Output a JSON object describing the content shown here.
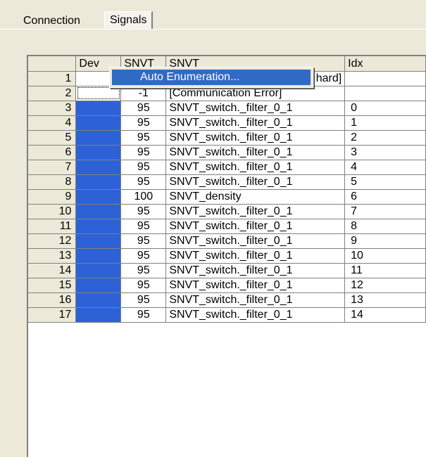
{
  "tabs": [
    {
      "label": "Connection"
    },
    {
      "label": "Signals"
    }
  ],
  "grid": {
    "headers": {
      "row": "",
      "dev": "Dev",
      "snvt_num": "SNVT",
      "snvt": "SNVT",
      "idx": "Idx"
    },
    "rows": [
      {
        "n": "1",
        "dev": "",
        "snvt_num": "",
        "snvt": "hard]",
        "idx": ""
      },
      {
        "n": "2",
        "dev": "",
        "snvt_num": "-1",
        "snvt": "[Communication Error]",
        "idx": ""
      },
      {
        "n": "3",
        "dev": "",
        "snvt_num": "95",
        "snvt": "SNVT_switch._filter_0_1",
        "idx": "0"
      },
      {
        "n": "4",
        "dev": "",
        "snvt_num": "95",
        "snvt": "SNVT_switch._filter_0_1",
        "idx": "1"
      },
      {
        "n": "5",
        "dev": "",
        "snvt_num": "95",
        "snvt": "SNVT_switch._filter_0_1",
        "idx": "2"
      },
      {
        "n": "6",
        "dev": "",
        "snvt_num": "95",
        "snvt": "SNVT_switch._filter_0_1",
        "idx": "3"
      },
      {
        "n": "7",
        "dev": "",
        "snvt_num": "95",
        "snvt": "SNVT_switch._filter_0_1",
        "idx": "4"
      },
      {
        "n": "8",
        "dev": "",
        "snvt_num": "95",
        "snvt": "SNVT_switch._filter_0_1",
        "idx": "5"
      },
      {
        "n": "9",
        "dev": "",
        "snvt_num": "100",
        "snvt": "SNVT_density",
        "idx": "6"
      },
      {
        "n": "10",
        "dev": "",
        "snvt_num": "95",
        "snvt": "SNVT_switch._filter_0_1",
        "idx": "7"
      },
      {
        "n": "11",
        "dev": "",
        "snvt_num": "95",
        "snvt": "SNVT_switch._filter_0_1",
        "idx": "8"
      },
      {
        "n": "12",
        "dev": "",
        "snvt_num": "95",
        "snvt": "SNVT_switch._filter_0_1",
        "idx": "9"
      },
      {
        "n": "13",
        "dev": "",
        "snvt_num": "95",
        "snvt": "SNVT_switch._filter_0_1",
        "idx": "10"
      },
      {
        "n": "14",
        "dev": "",
        "snvt_num": "95",
        "snvt": "SNVT_switch._filter_0_1",
        "idx": "11"
      },
      {
        "n": "15",
        "dev": "",
        "snvt_num": "95",
        "snvt": "SNVT_switch._filter_0_1",
        "idx": "12"
      },
      {
        "n": "16",
        "dev": "",
        "snvt_num": "95",
        "snvt": "SNVT_switch._filter_0_1",
        "idx": "13"
      },
      {
        "n": "17",
        "dev": "",
        "snvt_num": "95",
        "snvt": "SNVT_switch._filter_0_1",
        "idx": "14"
      }
    ]
  },
  "context_menu": {
    "item": "Auto Enumeration..."
  },
  "colors": {
    "dev_fill": "#2d62d6",
    "menu_highlight": "#316ac5"
  }
}
